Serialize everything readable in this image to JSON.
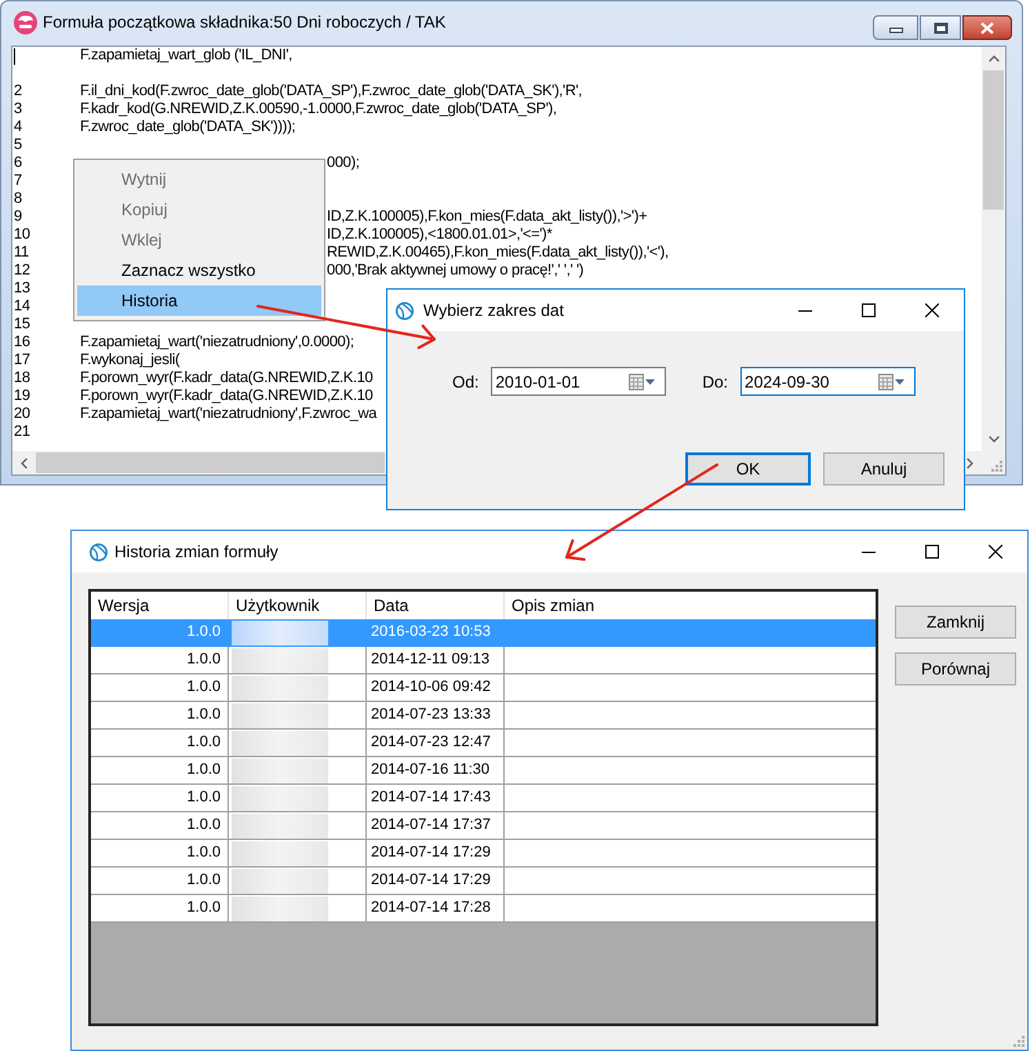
{
  "main_window": {
    "title": "Formuła początkowa składnika:50 Dni roboczych / TAK",
    "editor": {
      "lines": [
        {
          "kind": "caret_line",
          "text": "F.zapamietaj_wart_glob ('IL_DNI',"
        },
        {
          "kind": "blank"
        },
        {
          "kind": "line",
          "number": "2",
          "text": "F.il_dni_kod(F.zwroc_date_glob('DATA_SP'),F.zwroc_date_glob('DATA_SK'),'R',"
        },
        {
          "kind": "line",
          "number": "3",
          "text": "F.kadr_kod(G.NREWID,Z.K.00590,-1.0000,F.zwroc_date_glob('DATA_SP'),"
        },
        {
          "kind": "line",
          "number": "4",
          "text": "F.zwroc_date_glob('DATA_SK'))));"
        },
        {
          "kind": "line",
          "number": "5"
        },
        {
          "kind": "after_menu",
          "number": "6",
          "text": "000);"
        },
        {
          "kind": "line",
          "number": "7"
        },
        {
          "kind": "line",
          "number": "8"
        },
        {
          "kind": "after_menu",
          "number": "9",
          "text": "ID,Z.K.100005),F.kon_mies(F.data_akt_listy()),'>')+"
        },
        {
          "kind": "after_menu",
          "number": "10",
          "text": "ID,Z.K.100005),<1800.01.01>,'<=')*"
        },
        {
          "kind": "after_menu",
          "number": "11",
          "text": "REWID,Z.K.00465),F.kon_mies(F.data_akt_listy()),'<'),"
        },
        {
          "kind": "after_menu",
          "number": "12",
          "text": "000,'Brak aktywnej umowy o pracę!',' ',' ')"
        },
        {
          "kind": "line",
          "number": "13"
        },
        {
          "kind": "line",
          "number": "14"
        },
        {
          "kind": "line",
          "number": "15"
        },
        {
          "kind": "line",
          "number": "16",
          "text": "F.zapamietaj_wart('niezatrudniony',0.0000);"
        },
        {
          "kind": "line",
          "number": "17",
          "text": "F.wykonaj_jesli("
        },
        {
          "kind": "line",
          "number": "18",
          "text": "F.porown_wyr(F.kadr_data(G.NREWID,Z.K.10"
        },
        {
          "kind": "line",
          "number": "19",
          "text": "F.porown_wyr(F.kadr_data(G.NREWID,Z.K.10"
        },
        {
          "kind": "line",
          "number": "20",
          "text": "F.zapamietaj_wart('niezatrudniony',F.zwroc_wa"
        },
        {
          "kind": "line",
          "number": "21"
        }
      ]
    },
    "context_menu": {
      "items": [
        {
          "label": "Wytnij",
          "disabled": true,
          "selected": false
        },
        {
          "label": "Kopiuj",
          "disabled": true,
          "selected": false
        },
        {
          "label": "Wklej",
          "disabled": true,
          "selected": false
        },
        {
          "label": "Zaznacz wszystko",
          "disabled": false,
          "selected": false
        },
        {
          "label": "Historia",
          "disabled": false,
          "selected": true
        }
      ]
    }
  },
  "date_dialog": {
    "title": "Wybierz zakres dat",
    "fields": [
      {
        "label": "Od:",
        "value": "2010-01-01",
        "focused": false
      },
      {
        "label": "Do:",
        "value": "2024-09-30",
        "focused": true
      }
    ],
    "buttons": [
      {
        "label": "OK",
        "default": true
      },
      {
        "label": "Anuluj",
        "default": false
      }
    ]
  },
  "history_window": {
    "title": "Historia zmian formuły",
    "table": {
      "columns": [
        "Wersja",
        "Użytkownik",
        "Data",
        "Opis zmian"
      ],
      "rows": [
        {
          "version": "1.0.0",
          "user_blurred": true,
          "date": "2016-03-23 10:53",
          "selected": true
        },
        {
          "version": "1.0.0",
          "user_blurred": true,
          "date": "2014-12-11 09:13",
          "selected": false
        },
        {
          "version": "1.0.0",
          "user_blurred": true,
          "date": "2014-10-06 09:42",
          "selected": false
        },
        {
          "version": "1.0.0",
          "user_blurred": true,
          "date": "2014-07-23 13:33",
          "selected": false
        },
        {
          "version": "1.0.0",
          "user_blurred": true,
          "date": "2014-07-23 12:47",
          "selected": false
        },
        {
          "version": "1.0.0",
          "user_blurred": true,
          "date": "2014-07-16 11:30",
          "selected": false
        },
        {
          "version": "1.0.0",
          "user_blurred": true,
          "date": "2014-07-14 17:43",
          "selected": false
        },
        {
          "version": "1.0.0",
          "user_blurred": true,
          "date": "2014-07-14 17:37",
          "selected": false
        },
        {
          "version": "1.0.0",
          "user_blurred": true,
          "date": "2014-07-14 17:29",
          "selected": false
        },
        {
          "version": "1.0.0",
          "user_blurred": true,
          "date": "2014-07-14 17:29",
          "selected": false
        },
        {
          "version": "1.0.0",
          "user_blurred": true,
          "date": "2014-07-14 17:28",
          "selected": false
        }
      ]
    },
    "buttons": [
      "Zamknij",
      "Porównaj"
    ]
  }
}
